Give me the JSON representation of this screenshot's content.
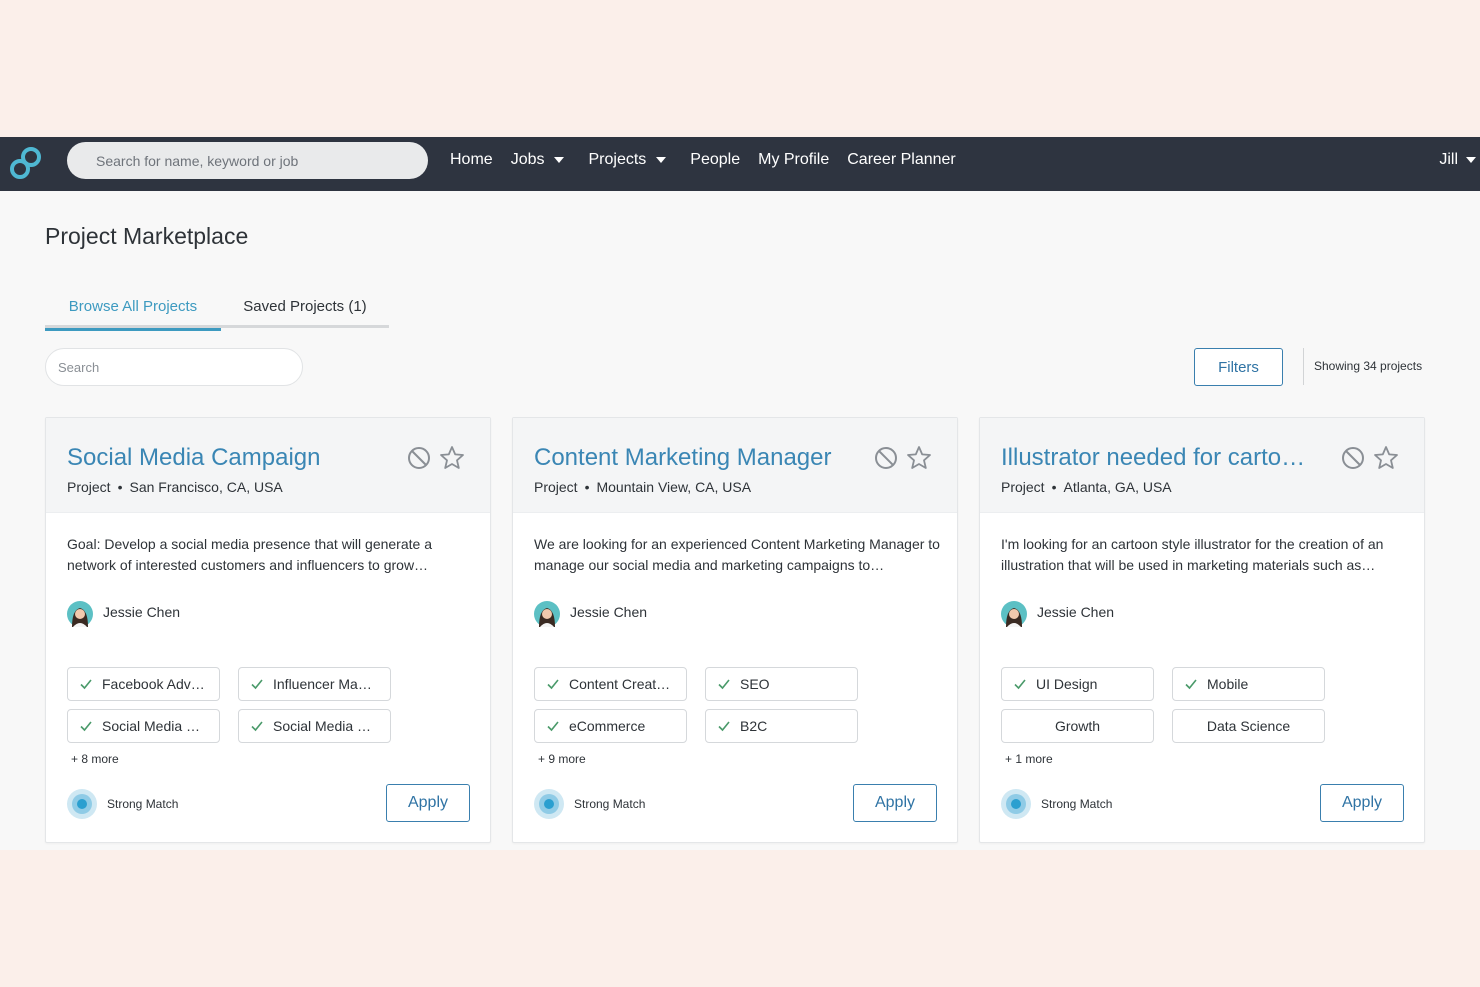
{
  "nav": {
    "search_placeholder": "Search for name, keyword or job",
    "links": [
      "Home",
      "Jobs",
      "Projects",
      "People",
      "My Profile",
      "Career Planner"
    ],
    "user": "Jill"
  },
  "page": {
    "title": "Project Marketplace",
    "tabs": [
      "Browse All Projects",
      "Saved Projects (1)"
    ],
    "search_placeholder": "Search",
    "filters_label": "Filters",
    "showing_text": "Showing 34 projects"
  },
  "cards": [
    {
      "title": "Social Media Campaign",
      "type": "Project",
      "location": "San Francisco, CA, USA",
      "description": "Goal: Develop a social media presence that will generate a network of interested customers and influencers to grow…",
      "author": "Jessie Chen",
      "skills": [
        "Facebook Adv…",
        "Influencer Ma…",
        "Social Media …",
        "Social Media …"
      ],
      "more": "+ 8 more",
      "match": "Strong Match",
      "apply": "Apply"
    },
    {
      "title": "Content Marketing Manager",
      "type": "Project",
      "location": "Mountain View, CA, USA",
      "description": "We are looking for an experienced Content Marketing Manager to manage our social media and marketing campaigns to…",
      "author": "Jessie Chen",
      "skills": [
        "Content Creat…",
        "SEO",
        "eCommerce",
        "B2C"
      ],
      "more": "+ 9 more",
      "match": "Strong Match",
      "apply": "Apply"
    },
    {
      "title": "Illustrator needed for carto…",
      "type": "Project",
      "location": "Atlanta, GA, USA",
      "description": "I'm looking for an cartoon style illustrator for the creation of an illustration that will be used in marketing materials such as…",
      "author": "Jessie Chen",
      "skills": [
        "UI Design",
        "Mobile",
        "Growth",
        "Data Science"
      ],
      "more": "+ 1 more",
      "match": "Strong Match",
      "apply": "Apply"
    }
  ],
  "colors": {
    "nav_bg": "#2e3440",
    "accent": "#3d9ac0",
    "link": "#3a86b4",
    "button": "#2f73a4",
    "outer_bg": "#fbefea",
    "match": "#2a9fd0"
  },
  "icons": {
    "logo": "infinity-logo-icon",
    "hide": "ban-icon",
    "save": "star-icon",
    "skill": "check-icon",
    "match": "target-icon"
  }
}
